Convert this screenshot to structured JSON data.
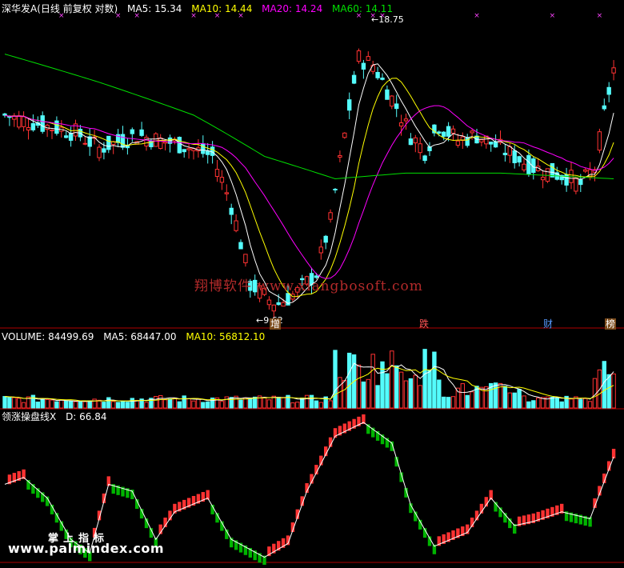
{
  "price_header": {
    "title": "深华发A(日线 前复权 对数)",
    "ma5": "MA5: 15.34",
    "ma10": "MA10: 14.44",
    "ma20": "MA20: 14.24",
    "ma60": "MA60: 14.11"
  },
  "volume_header": {
    "volume": "VOLUME: 84499.69",
    "ma5": "MA5: 68447.00",
    "ma10": "MA10: 56812.10"
  },
  "osc_header": {
    "name": "领涨操盘线X",
    "d": "D: 66.84"
  },
  "annotations": {
    "high": "18.75",
    "low": "9.62"
  },
  "events": [
    "增",
    "跌",
    "财",
    "榜"
  ],
  "watermark": "翔博软件 www.xiangbosoft.com",
  "site_logo": {
    "line1": "掌上指标",
    "line2": "www.palmindex.com"
  },
  "colors": {
    "up": "#ff3232",
    "down": "#54fcfc",
    "ma5": "#ffffff",
    "ma10": "#ffff00",
    "ma20": "#ff00ff",
    "ma60": "#00e000",
    "osc_up": "#ff3232",
    "osc_down": "#00b400"
  },
  "chart_data": [
    {
      "type": "candlestick",
      "title": "深华发A(日线 前复权 对数)",
      "log_scale": true,
      "ylim": [
        9.3,
        20.5
      ],
      "series_names": [
        "MA5",
        "MA10",
        "MA20",
        "MA60"
      ],
      "marked_high": 18.75,
      "marked_low": 9.62
    },
    {
      "type": "bar",
      "title": "VOLUME",
      "values_latest": {
        "VOLUME": 84499.69,
        "MA5": 68447.0,
        "MA10": 56812.1
      }
    },
    {
      "type": "line",
      "title": "领涨操盘线X",
      "values_latest": {
        "D": 66.84
      }
    }
  ]
}
